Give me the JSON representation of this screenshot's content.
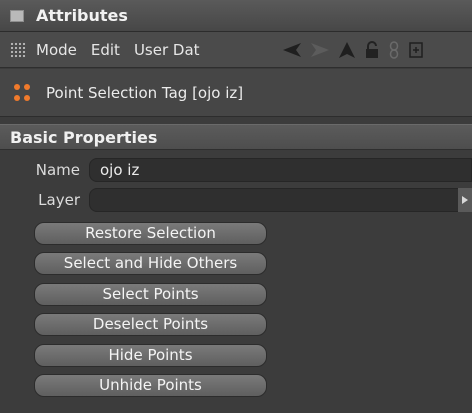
{
  "panel": {
    "title": "Attributes"
  },
  "menu": {
    "items": [
      "Mode",
      "Edit",
      "User Dat"
    ]
  },
  "toolbar": {
    "icons": [
      "back-arrow-icon",
      "forward-arrow-icon",
      "up-arrow-icon",
      "lock-icon",
      "link-icon",
      "new-panel-icon"
    ]
  },
  "object": {
    "title": "Point Selection Tag [ojo iz]",
    "icon": "point-selection-tag-icon",
    "icon_color": "#f07a2c"
  },
  "section": {
    "title": "Basic Properties"
  },
  "fields": {
    "name_label": "Name",
    "name_value": "ojo iz",
    "layer_label": "Layer",
    "layer_value": ""
  },
  "buttons": [
    "Restore Selection",
    "Select and Hide Others",
    "Select Points",
    "Deselect Points",
    "Hide Points",
    "Unhide Points"
  ]
}
